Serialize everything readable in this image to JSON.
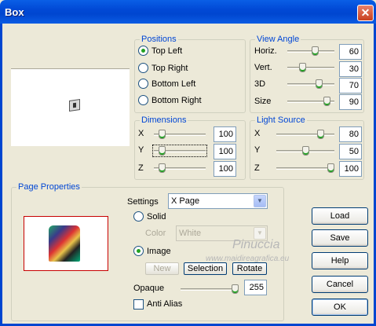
{
  "window": {
    "title": "Box",
    "close_glyph": "✕"
  },
  "positions": {
    "label": "Positions",
    "options": [
      "Top Left",
      "Top Right",
      "Bottom Left",
      "Bottom Right"
    ],
    "selected": "Top Left"
  },
  "view_angle": {
    "label": "View Angle",
    "rows": [
      {
        "label": "Horiz.",
        "value": "60",
        "level": 0.6
      },
      {
        "label": "Vert.",
        "value": "30",
        "level": 0.3
      },
      {
        "label": "3D",
        "value": "70",
        "level": 0.7
      },
      {
        "label": "Size",
        "value": "90",
        "level": 0.9
      }
    ]
  },
  "dimensions": {
    "label": "Dimensions",
    "rows": [
      {
        "label": "X",
        "value": "100",
        "level": 0.1
      },
      {
        "label": "Y",
        "value": "100",
        "level": 0.1
      },
      {
        "label": "Z",
        "value": "100",
        "level": 0.1
      }
    ]
  },
  "light_source": {
    "label": "Light Source",
    "rows": [
      {
        "label": "X",
        "value": "80",
        "level": 0.8
      },
      {
        "label": "Y",
        "value": "50",
        "level": 0.5
      },
      {
        "label": "Z",
        "value": "100",
        "level": 1.0
      }
    ]
  },
  "page_properties": {
    "label": "Page Properties",
    "settings_label": "Settings",
    "settings_value": "X Page",
    "solid_label": "Solid",
    "color_label": "Color",
    "color_value": "White",
    "image_label": "Image",
    "fill_selected": "Image",
    "new_label": "New",
    "selection_label": "Selection",
    "rotate_label": "Rotate",
    "opaque_label": "Opaque",
    "opaque_value": "255",
    "opaque_level": 1.0,
    "anti_alias_label": "Anti Alias",
    "anti_alias_checked": false
  },
  "buttons": {
    "load": "Load",
    "save": "Save",
    "help": "Help",
    "cancel": "Cancel",
    "ok": "OK"
  },
  "watermark": {
    "line1": "Pinuccia",
    "line2": "www.maidireagrafica.eu"
  },
  "colors": {
    "title_bar": "#0046d0",
    "group_label": "#0046d5",
    "dialog_bg": "#ece9d8",
    "radio_dot": "#21a121"
  }
}
